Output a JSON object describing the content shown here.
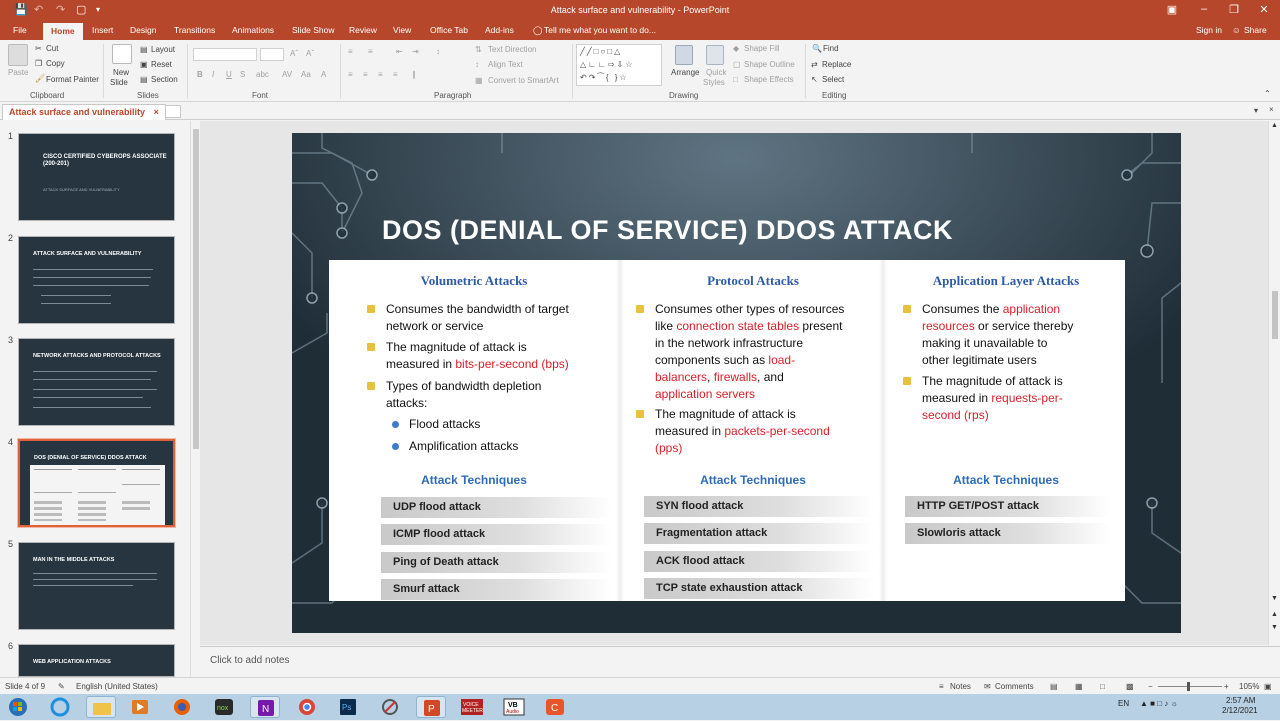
{
  "window": {
    "title": "Attack surface and vulnerability - PowerPoint",
    "sign_in": "Sign in",
    "share": "Share"
  },
  "tabs": [
    "File",
    "Home",
    "Insert",
    "Design",
    "Transitions",
    "Animations",
    "Slide Show",
    "Review",
    "View",
    "Office Tab",
    "Add-ins"
  ],
  "tell_me": "Tell me what you want to do...",
  "ribbon": {
    "clipboard": {
      "paste": "Paste",
      "cut": "Cut",
      "copy": "Copy",
      "format_painter": "Format Painter",
      "label": "Clipboard"
    },
    "slides": {
      "new_slide": "New",
      "new_slide2": "Slide",
      "layout": "Layout",
      "reset": "Reset",
      "section": "Section",
      "label": "Slides"
    },
    "font": {
      "label": "Font"
    },
    "paragraph": {
      "text_direction": "Text Direction",
      "align_text": "Align Text",
      "smartart": "Convert to SmartArt",
      "label": "Paragraph"
    },
    "drawing": {
      "arrange": "Arrange",
      "quick_styles": "Quick",
      "quick_styles2": "Styles",
      "shape_fill": "Shape Fill",
      "shape_outline": "Shape Outline",
      "shape_effects": "Shape Effects",
      "label": "Drawing"
    },
    "editing": {
      "find": "Find",
      "replace": "Replace",
      "select": "Select",
      "label": "Editing"
    }
  },
  "doc_tab": "Attack surface and vulnerability",
  "thumbnails": [
    {
      "num": "1",
      "title": "CISCO CERTIFIED CYBEROPS ASSOCIATE (200-201)",
      "sub": "ATTACK SURFACE AND VULNERABILITY"
    },
    {
      "num": "2",
      "title": "ATTACK SURFACE AND VULNERABILITY"
    },
    {
      "num": "3",
      "title": "NETWORK ATTACKS AND PROTOCOL ATTACKS"
    },
    {
      "num": "4",
      "title": "DOS (DENIAL OF SERVICE) DDOS ATTACK"
    },
    {
      "num": "5",
      "title": "MAN IN THE MIDDLE ATTACKS"
    },
    {
      "num": "6",
      "title": "WEB APPLICATION ATTACKS"
    }
  ],
  "slide": {
    "title": "DOS (DENIAL OF SERVICE) DDOS ATTACK",
    "columns": [
      {
        "header": "Volumetric Attacks",
        "bullets": [
          {
            "l1": "Consumes the bandwidth of target",
            "l2": "network or service"
          },
          {
            "l1": "The magnitude of attack is",
            "l2a": "measured in ",
            "l2b": "bits-per-second (bps)"
          },
          {
            "l1": "Types of bandwidth depletion",
            "l2": "attacks:"
          }
        ],
        "subs": [
          "Flood attacks",
          "Amplification attacks"
        ],
        "techniques_label": "Attack Techniques",
        "techniques": [
          "UDP flood attack",
          "ICMP flood attack",
          "Ping of Death attack",
          "Smurf attack"
        ]
      },
      {
        "header": "Protocol Attacks",
        "b1": {
          "l1": "Consumes other types of resources",
          "l2a": "like ",
          "l2b": "connection state tables",
          "l2c": " present",
          "l3": "in the network infrastructure",
          "l4a": "components such as ",
          "l4b": "load-",
          "l5a": "balancers",
          "l5b": ", ",
          "l5c": "firewalls",
          "l5d": ", and",
          "l6": "application servers"
        },
        "b2": {
          "l1": "The magnitude of attack is",
          "l2a": "measured in ",
          "l2b": "packets-per-second",
          "l3": "(pps)"
        },
        "techniques_label": "Attack Techniques",
        "techniques": [
          "SYN flood attack",
          "Fragmentation attack",
          "ACK flood attack",
          "TCP state exhaustion attack"
        ]
      },
      {
        "header": "Application Layer Attacks",
        "b1": {
          "l1a": "Consumes the ",
          "l1b": "application",
          "l2a": "resources",
          "l2b": " or service thereby",
          "l3": "making it unavailable to",
          "l4": "other legitimate users"
        },
        "b2": {
          "l1": "The magnitude of attack is",
          "l2a": "measured in ",
          "l2b": "requests-per-",
          "l3": "second (rps)"
        },
        "techniques_label": "Attack Techniques",
        "techniques": [
          "HTTP GET/POST attack",
          "Slowloris attack"
        ]
      }
    ]
  },
  "notes_placeholder": "Click to add notes",
  "status": {
    "slide": "Slide 4 of 9",
    "language": "English (United States)",
    "notes": "Notes",
    "comments": "Comments",
    "zoom": "105%"
  },
  "taskbar": {
    "lang": "EN",
    "time": "2:57 AM",
    "date": "2/12/2021"
  },
  "colors": {
    "accent": "#b7472a",
    "slide_bg": "#22313c",
    "header_blue": "#2e5ba8",
    "highlight_red": "#d91e2a",
    "bullet_yellow": "#e8c23a"
  }
}
